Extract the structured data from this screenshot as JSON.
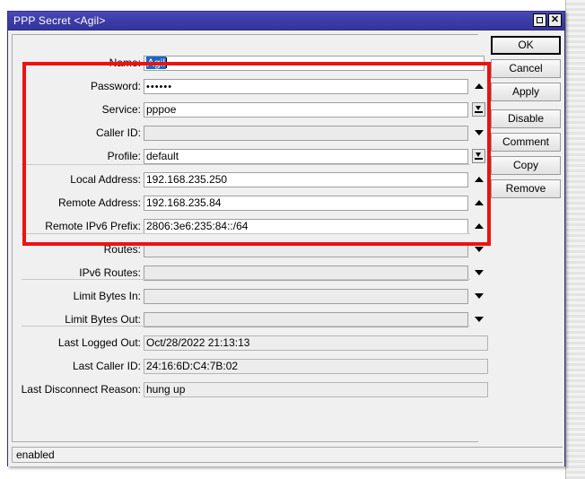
{
  "window": {
    "title": "PPP Secret <Agil>",
    "maximize_icon": "maximize-icon",
    "close_icon": "close-icon",
    "close_glyph": "✕"
  },
  "form": {
    "rows": [
      {
        "label": "Name:",
        "value": "Agil",
        "state": "selected",
        "control": "none",
        "field_width": 380
      },
      {
        "label": "Password:",
        "value": "••••••",
        "state": "normal",
        "control": "tri-up",
        "field_width": 362
      },
      {
        "label": "Service:",
        "value": "pppoe",
        "state": "normal",
        "control": "btn-down",
        "field_width": 362
      },
      {
        "label": "Caller ID:",
        "value": "",
        "state": "disabled",
        "control": "tri-down",
        "field_width": 362
      },
      {
        "label": "Profile:",
        "value": "default",
        "state": "normal",
        "control": "btn-down",
        "field_width": 362
      },
      {
        "label": "Local Address:",
        "value": "192.168.235.250",
        "state": "normal",
        "control": "tri-up",
        "field_width": 362
      },
      {
        "label": "Remote Address:",
        "value": "192.168.235.84",
        "state": "normal",
        "control": "tri-up",
        "field_width": 362
      },
      {
        "label": "Remote IPv6 Prefix:",
        "value": "2806:3e6:235:84::/64",
        "state": "normal",
        "control": "tri-up",
        "field_width": 362
      },
      {
        "label": "Routes:",
        "value": "",
        "state": "disabled",
        "control": "tri-down",
        "field_width": 362
      },
      {
        "label": "IPv6 Routes:",
        "value": "",
        "state": "disabled",
        "control": "tri-down",
        "field_width": 362
      },
      {
        "label": "Limit Bytes In:",
        "value": "",
        "state": "disabled",
        "control": "tri-down",
        "field_width": 362
      },
      {
        "label": "Limit Bytes Out:",
        "value": "",
        "state": "disabled",
        "control": "tri-down",
        "field_width": 362
      },
      {
        "label": "Last Logged Out:",
        "value": "Oct/28/2022 21:13:13",
        "state": "readonly",
        "control": "none",
        "field_width": 384
      },
      {
        "label": "Last Caller ID:",
        "value": "24:16:6D:C4:7B:02",
        "state": "readonly",
        "control": "none",
        "field_width": 384
      },
      {
        "label": "Last Disconnect Reason:",
        "value": "hung up",
        "state": "readonly",
        "control": "none",
        "field_width": 384
      }
    ]
  },
  "buttons": [
    {
      "label": "OK",
      "default": true
    },
    {
      "label": "Cancel",
      "default": false
    },
    {
      "label": "Apply",
      "default": false
    },
    {
      "label": "Disable",
      "default": false
    },
    {
      "label": "Comment",
      "default": false
    },
    {
      "label": "Copy",
      "default": false
    },
    {
      "label": "Remove",
      "default": false
    }
  ],
  "statusbar": {
    "text": "enabled"
  },
  "annotation": {
    "color": "#ee1111",
    "shape": "rectangle"
  },
  "colors": {
    "titlebar": "#3c3ca8",
    "selection": "#1668c8",
    "window_face": "#f0f0f0",
    "annotation_red": "#ee1111"
  }
}
